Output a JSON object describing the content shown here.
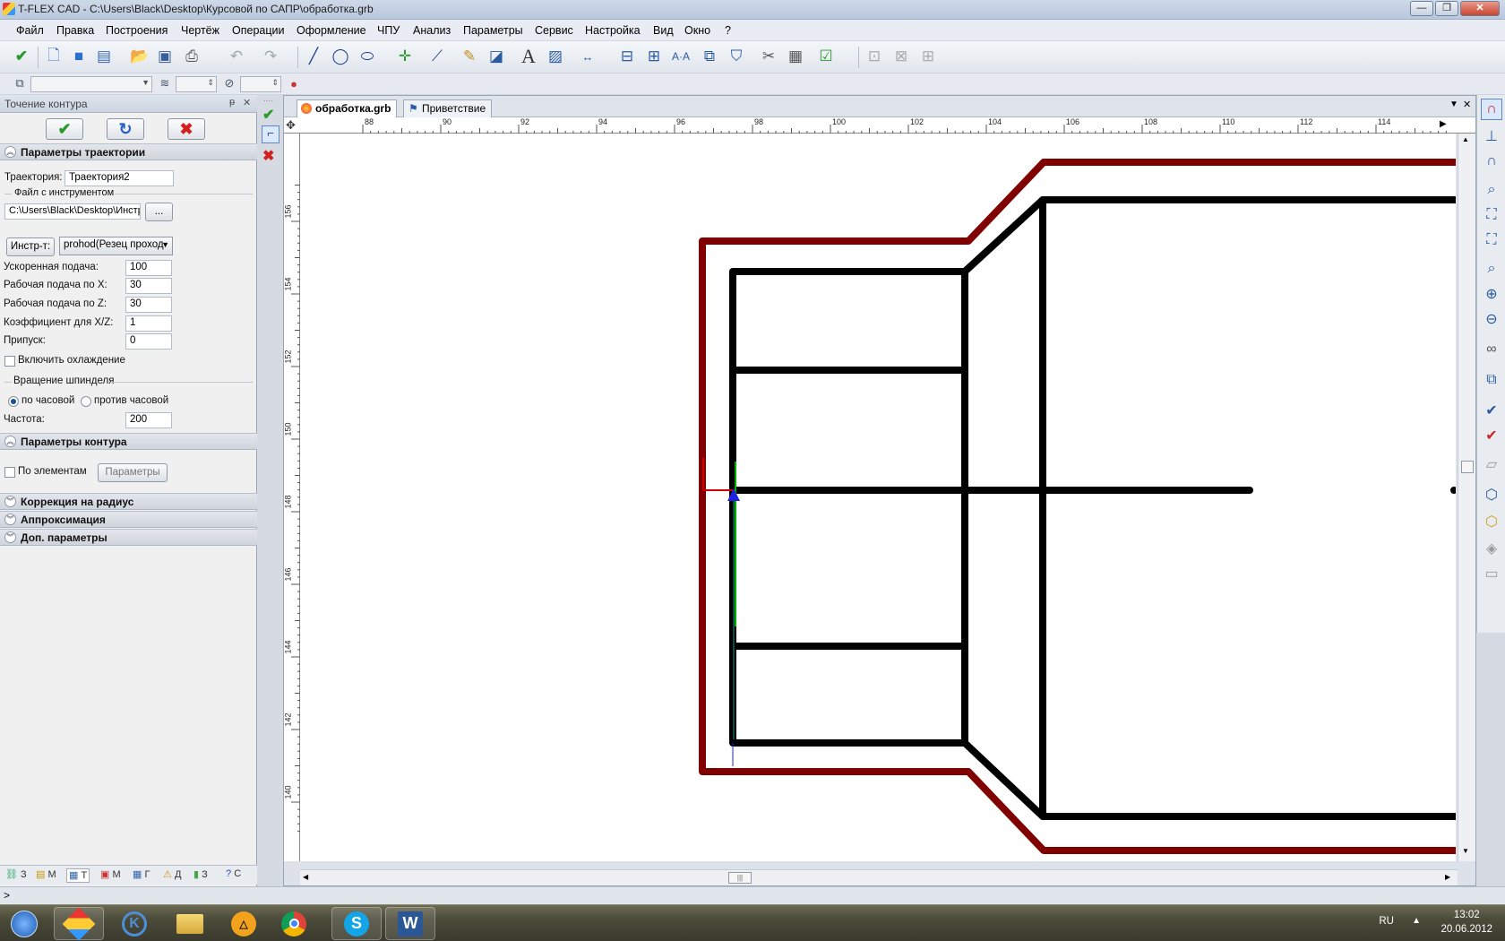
{
  "window": {
    "title": "T-FLEX CAD - C:\\Users\\Black\\Desktop\\Курсовой по САПР\\обработка.grb",
    "minimize": "—",
    "restore": "❐",
    "close": "✕"
  },
  "menu": [
    "Файл",
    "Правка",
    "Построения",
    "Чертёж",
    "Операции",
    "Оформление",
    "ЧПУ",
    "Анализ",
    "Параметры",
    "Сервис",
    "Настройка",
    "Вид",
    "Окно",
    "?"
  ],
  "toolbar2": {
    "color_swatch": "#000000"
  },
  "panel": {
    "title": "Точение контура",
    "pin": "ᵽ",
    "close": "✕",
    "ok": "✔",
    "refresh": "↻",
    "cancel": "✖",
    "sections": {
      "trajectory": "Параметры траектории",
      "contour": "Параметры контура",
      "radius": "Коррекция на радиус",
      "approx": "Аппроксимация",
      "extra": "Доп. параметры"
    },
    "trajectory_label": "Траектория:",
    "trajectory_value": "Траектория2",
    "tool_file_group": "Файл с инструментом",
    "tool_file_path": "C:\\Users\\Black\\Desktop\\Инстр",
    "browse": "...",
    "tool_button": "Инстр-т:",
    "tool_select": "prohod(Резец проход",
    "rapid_label": "Ускоренная подача:",
    "rapid_value": "100",
    "feed_x_label": "Рабочая подача по X:",
    "feed_x_value": "30",
    "feed_z_label": "Рабочая подача по Z:",
    "feed_z_value": "30",
    "coef_label": "Коэффициент для X/Z:",
    "coef_value": "1",
    "allowance_label": "Припуск:",
    "allowance_value": "0",
    "cooling_label": "Включить охлаждение",
    "spindle_group": "Вращение шпинделя",
    "cw_label": "по часовой",
    "ccw_label": "против часовой",
    "freq_label": "Частота:",
    "freq_value": "200",
    "by_elements_label": "По элементам",
    "params_button": "Параметры",
    "bottom_tabs": [
      "З",
      "М",
      "Т",
      "М",
      "Г",
      "Д",
      "З",
      "С"
    ]
  },
  "document": {
    "tabs": [
      "обработка.grb",
      "Приветствие"
    ],
    "ruler_top": [
      "88",
      "90",
      "92",
      "94",
      "96",
      "98",
      "100",
      "102",
      "104",
      "106",
      "108",
      "110",
      "112",
      "114"
    ],
    "ruler_left": [
      "156",
      "154",
      "152",
      "150",
      "148",
      "146",
      "144",
      "142",
      "140"
    ],
    "colors": {
      "contour": "#800000",
      "part": "#000000",
      "axis_x": "#d00000",
      "axis_y": "#00b000",
      "axis_z": "#2020e0"
    }
  },
  "statusbar": {
    "text": ">"
  },
  "taskbar": {
    "lang": "RU",
    "time": "13:02",
    "date": "20.06.2012",
    "apps": [
      "windows-start-icon",
      "tflex-icon",
      "k-icon",
      "folder-icon",
      "aimp-icon",
      "chrome-icon",
      "skype-icon",
      "word-icon"
    ]
  }
}
